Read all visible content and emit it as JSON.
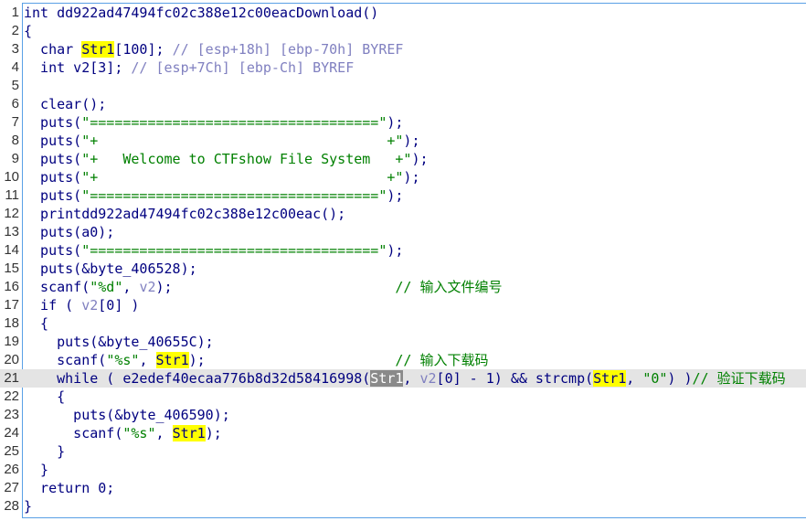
{
  "lines": [
    {
      "n": "1",
      "seg": [
        {
          "t": "int dd922ad47494fc02c388e12c00eacDownload()",
          "c": ""
        }
      ]
    },
    {
      "n": "2",
      "seg": [
        {
          "t": "{",
          "c": ""
        }
      ]
    },
    {
      "n": "3",
      "seg": [
        {
          "t": "  char ",
          "c": ""
        },
        {
          "t": "Str1",
          "c": "hl"
        },
        {
          "t": "[100]; ",
          "c": ""
        },
        {
          "t": "// [esp+18h] [ebp-70h] BYREF",
          "c": "va"
        }
      ]
    },
    {
      "n": "4",
      "seg": [
        {
          "t": "  int v2[3]; ",
          "c": ""
        },
        {
          "t": "// [esp+7Ch] [ebp-Ch] BYREF",
          "c": "va"
        }
      ]
    },
    {
      "n": "5",
      "seg": [
        {
          "t": "",
          "c": ""
        }
      ]
    },
    {
      "n": "6",
      "seg": [
        {
          "t": "  clear();",
          "c": ""
        }
      ]
    },
    {
      "n": "7",
      "seg": [
        {
          "t": "  puts(",
          "c": ""
        },
        {
          "t": "\"===================================\"",
          "c": "st"
        },
        {
          "t": ");",
          "c": ""
        }
      ]
    },
    {
      "n": "8",
      "seg": [
        {
          "t": "  puts(",
          "c": ""
        },
        {
          "t": "\"+                                   +\"",
          "c": "st"
        },
        {
          "t": ");",
          "c": ""
        }
      ]
    },
    {
      "n": "9",
      "seg": [
        {
          "t": "  puts(",
          "c": ""
        },
        {
          "t": "\"+   Welcome to CTFshow File System   +\"",
          "c": "st"
        },
        {
          "t": ");",
          "c": ""
        }
      ]
    },
    {
      "n": "10",
      "seg": [
        {
          "t": "  puts(",
          "c": ""
        },
        {
          "t": "\"+                                   +\"",
          "c": "st"
        },
        {
          "t": ");",
          "c": ""
        }
      ]
    },
    {
      "n": "11",
      "seg": [
        {
          "t": "  puts(",
          "c": ""
        },
        {
          "t": "\"===================================\"",
          "c": "st"
        },
        {
          "t": ");",
          "c": ""
        }
      ]
    },
    {
      "n": "12",
      "seg": [
        {
          "t": "  printdd922ad47494fc02c388e12c00eac();",
          "c": ""
        }
      ]
    },
    {
      "n": "13",
      "seg": [
        {
          "t": "  puts(a0);",
          "c": ""
        }
      ]
    },
    {
      "n": "14",
      "seg": [
        {
          "t": "  puts(",
          "c": ""
        },
        {
          "t": "\"===================================\"",
          "c": "st"
        },
        {
          "t": ");",
          "c": ""
        }
      ]
    },
    {
      "n": "15",
      "seg": [
        {
          "t": "  puts(&byte_406528);",
          "c": ""
        }
      ]
    },
    {
      "n": "16",
      "seg": [
        {
          "t": "  scanf(",
          "c": ""
        },
        {
          "t": "\"%d\"",
          "c": "st"
        },
        {
          "t": ", ",
          "c": ""
        },
        {
          "t": "v2",
          "c": "va"
        },
        {
          "t": ");                           ",
          "c": ""
        },
        {
          "t": "// 输入文件编号",
          "c": "cm"
        }
      ]
    },
    {
      "n": "17",
      "seg": [
        {
          "t": "  if ( ",
          "c": ""
        },
        {
          "t": "v2",
          "c": "va"
        },
        {
          "t": "[0] )",
          "c": ""
        }
      ]
    },
    {
      "n": "18",
      "seg": [
        {
          "t": "  {",
          "c": ""
        }
      ]
    },
    {
      "n": "19",
      "seg": [
        {
          "t": "    puts(&byte_40655C);",
          "c": ""
        }
      ]
    },
    {
      "n": "20",
      "seg": [
        {
          "t": "    scanf(",
          "c": ""
        },
        {
          "t": "\"%s\"",
          "c": "st"
        },
        {
          "t": ", ",
          "c": ""
        },
        {
          "t": "Str1",
          "c": "hl"
        },
        {
          "t": ");                       ",
          "c": ""
        },
        {
          "t": "// 输入下载码",
          "c": "cm"
        }
      ]
    },
    {
      "n": "21",
      "current": true,
      "seg": [
        {
          "t": "    while ( e2edef40ecaa776b8d32d58416998(",
          "c": ""
        },
        {
          "t": "Str1",
          "c": "hl2"
        },
        {
          "t": ", ",
          "c": ""
        },
        {
          "t": "v2",
          "c": "va"
        },
        {
          "t": "[0] - 1) && strcmp(",
          "c": ""
        },
        {
          "t": "Str1",
          "c": "hl"
        },
        {
          "t": ", ",
          "c": ""
        },
        {
          "t": "\"0\"",
          "c": "st"
        },
        {
          "t": ") )",
          "c": ""
        },
        {
          "t": "// 验证下载码",
          "c": "cm"
        }
      ]
    },
    {
      "n": "22",
      "seg": [
        {
          "t": "    {",
          "c": ""
        }
      ]
    },
    {
      "n": "23",
      "seg": [
        {
          "t": "      puts(&byte_406590);",
          "c": ""
        }
      ]
    },
    {
      "n": "24",
      "seg": [
        {
          "t": "      scanf(",
          "c": ""
        },
        {
          "t": "\"%s\"",
          "c": "st"
        },
        {
          "t": ", ",
          "c": ""
        },
        {
          "t": "Str1",
          "c": "hl"
        },
        {
          "t": ");",
          "c": ""
        }
      ]
    },
    {
      "n": "25",
      "seg": [
        {
          "t": "    }",
          "c": ""
        }
      ]
    },
    {
      "n": "26",
      "seg": [
        {
          "t": "  }",
          "c": ""
        }
      ]
    },
    {
      "n": "27",
      "seg": [
        {
          "t": "  return 0;",
          "c": ""
        }
      ]
    },
    {
      "n": "28",
      "seg": [
        {
          "t": "}",
          "c": ""
        }
      ]
    }
  ]
}
